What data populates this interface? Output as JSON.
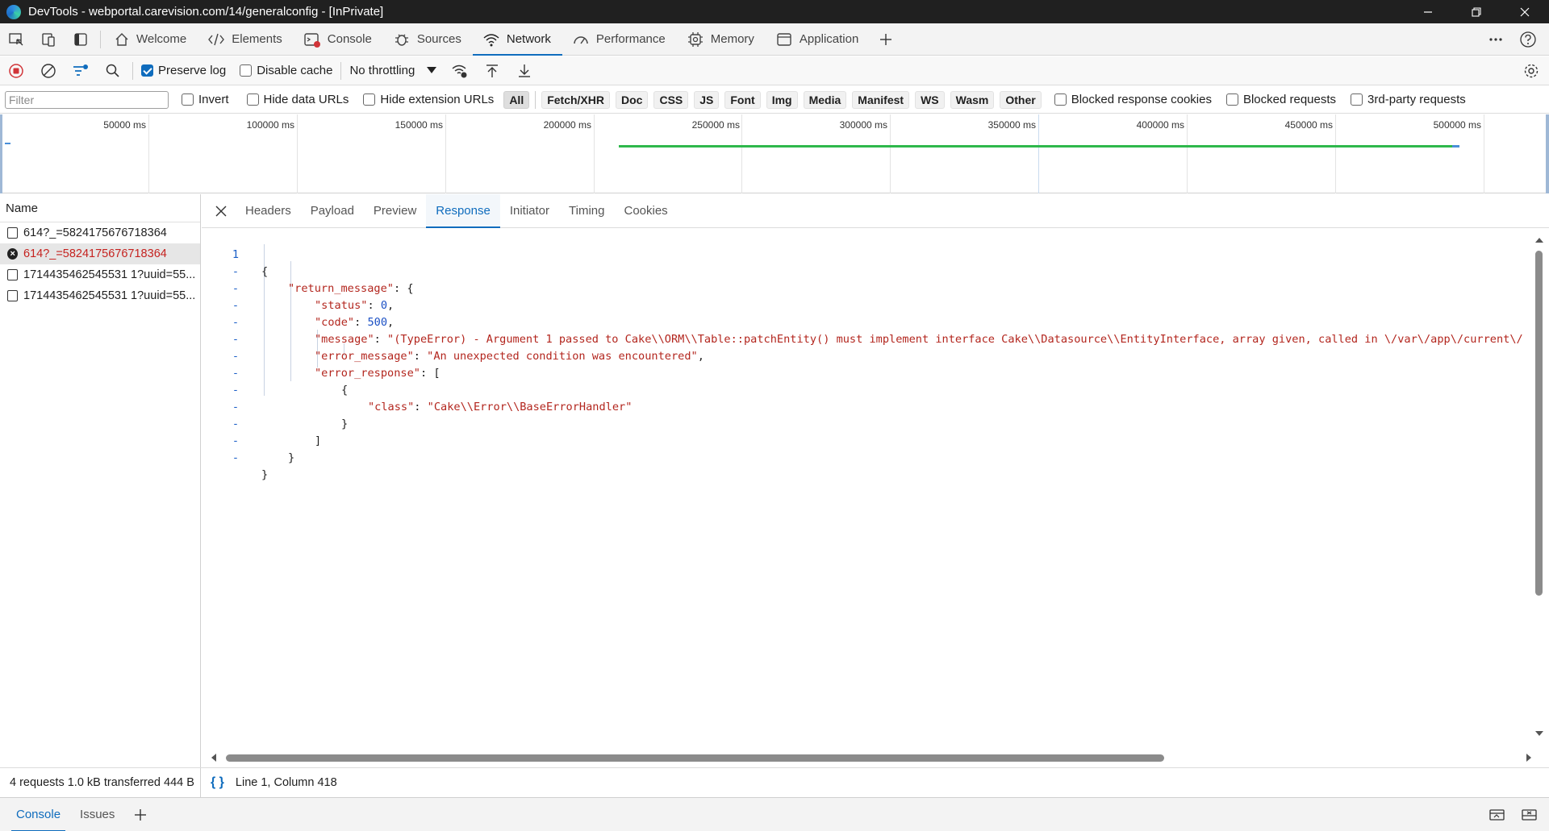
{
  "window": {
    "title": "DevTools - webportal.carevision.com/14/generalconfig - [InPrivate]"
  },
  "main_tabs": [
    {
      "label": "Welcome",
      "icon": "home-icon"
    },
    {
      "label": "Elements",
      "icon": "code-icon"
    },
    {
      "label": "Console",
      "icon": "console-icon"
    },
    {
      "label": "Sources",
      "icon": "bug-icon"
    },
    {
      "label": "Network",
      "icon": "wifi-icon",
      "active": true
    },
    {
      "label": "Performance",
      "icon": "gauge-icon"
    },
    {
      "label": "Memory",
      "icon": "chip-icon"
    },
    {
      "label": "Application",
      "icon": "window-icon"
    }
  ],
  "toolbar": {
    "preserve_log": {
      "label": "Preserve log",
      "checked": true
    },
    "disable_cache": {
      "label": "Disable cache",
      "checked": false
    },
    "throttling": "No throttling"
  },
  "filterbar": {
    "placeholder": "Filter",
    "invert": "Invert",
    "hide_data_urls": "Hide data URLs",
    "hide_extension_urls": "Hide extension URLs",
    "types": [
      "All",
      "Fetch/XHR",
      "Doc",
      "CSS",
      "JS",
      "Font",
      "Img",
      "Media",
      "Manifest",
      "WS",
      "Wasm",
      "Other"
    ],
    "active_type": "All",
    "blocked_response_cookies": "Blocked response cookies",
    "blocked_requests": "Blocked requests",
    "third_party": "3rd-party requests"
  },
  "overview": {
    "ticks": [
      "50000 ms",
      "100000 ms",
      "150000 ms",
      "200000 ms",
      "250000 ms",
      "300000 ms",
      "350000 ms",
      "400000 ms",
      "450000 ms",
      "500000 ms"
    ]
  },
  "request_list": {
    "header": "Name",
    "items": [
      {
        "name": "614?_=5824175676718364",
        "error": false,
        "selected": false
      },
      {
        "name": "614?_=5824175676718364",
        "error": true,
        "selected": true
      },
      {
        "name": "1714435462545531 1?uuid=55...",
        "error": false,
        "selected": false
      },
      {
        "name": "1714435462545531 1?uuid=55...",
        "error": false,
        "selected": false
      }
    ]
  },
  "detail_tabs": [
    "Headers",
    "Payload",
    "Preview",
    "Response",
    "Initiator",
    "Timing",
    "Cookies"
  ],
  "active_detail_tab": "Response",
  "response": {
    "gutter": [
      "1",
      "-",
      "-",
      "-",
      "-",
      "-",
      "-",
      "-",
      "-",
      "-",
      "-",
      "-",
      "-"
    ],
    "lines": [
      "{",
      "\"return_message\": {",
      "\"status\": 0,",
      "\"code\": 500,",
      "\"message\": \"(TypeError) - Argument 1 passed to Cake\\\\ORM\\\\Table::patchEntity() must implement interface Cake\\\\Datasource\\\\EntityInterface, array given, called in \\/var\\/app\\/current\\/",
      "\"error_message\": \"An unexpected condition was encountered\",",
      "\"error_response\": [",
      "{",
      "\"class\": \"Cake\\\\Error\\\\BaseErrorHandler\"",
      "}",
      "]",
      "}",
      "}"
    ],
    "tokens": {
      "l2_key": "\"return_message\"",
      "l3_key": "\"status\"",
      "l3_val": "0",
      "l4_key": "\"code\"",
      "l4_val": "500",
      "l5_key": "\"message\"",
      "l5_val": "\"(TypeError) - Argument 1 passed to Cake\\\\ORM\\\\Table::patchEntity() must implement interface Cake\\\\Datasource\\\\EntityInterface, array given, called in \\/var\\/app\\/current\\/",
      "l6_key": "\"error_message\"",
      "l6_val": "\"An unexpected condition was encountered\"",
      "l7_key": "\"error_response\"",
      "l9_key": "\"class\"",
      "l9_val": "\"Cake\\\\Error\\\\BaseErrorHandler\""
    }
  },
  "status": {
    "summary": "4 requests  1.0 kB transferred  444 B",
    "pretty_print": "{ }",
    "cursor": "Line 1, Column 418"
  },
  "drawer": {
    "tabs": [
      "Console",
      "Issues"
    ],
    "active": "Console"
  },
  "colors": {
    "accent": "#0f6cbd",
    "error": "#c5221f",
    "timeline_green": "#2eb84b"
  }
}
